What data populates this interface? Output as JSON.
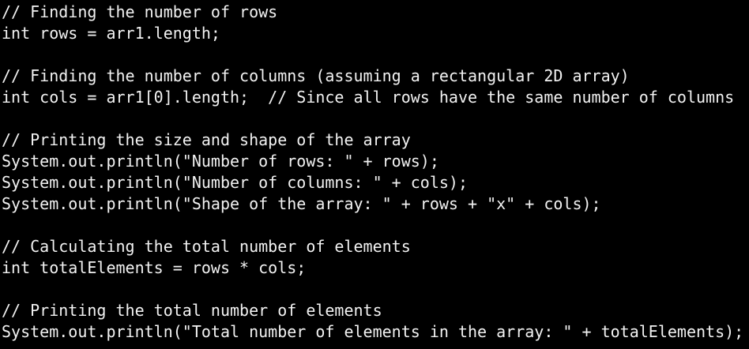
{
  "editor": {
    "background_color": "#000000",
    "text_color": "#f2f2f2",
    "lines": [
      "// Finding the number of rows",
      "int rows = arr1.length;",
      "",
      "// Finding the number of columns (assuming a rectangular 2D array)",
      "int cols = arr1[0].length;  // Since all rows have the same number of columns",
      "",
      "// Printing the size and shape of the array",
      "System.out.println(\"Number of rows: \" + rows);",
      "System.out.println(\"Number of columns: \" + cols);",
      "System.out.println(\"Shape of the array: \" + rows + \"x\" + cols);",
      "",
      "// Calculating the total number of elements",
      "int totalElements = rows * cols;",
      "",
      "// Printing the total number of elements",
      "System.out.println(\"Total number of elements in the array: \" + totalElements);"
    ]
  }
}
